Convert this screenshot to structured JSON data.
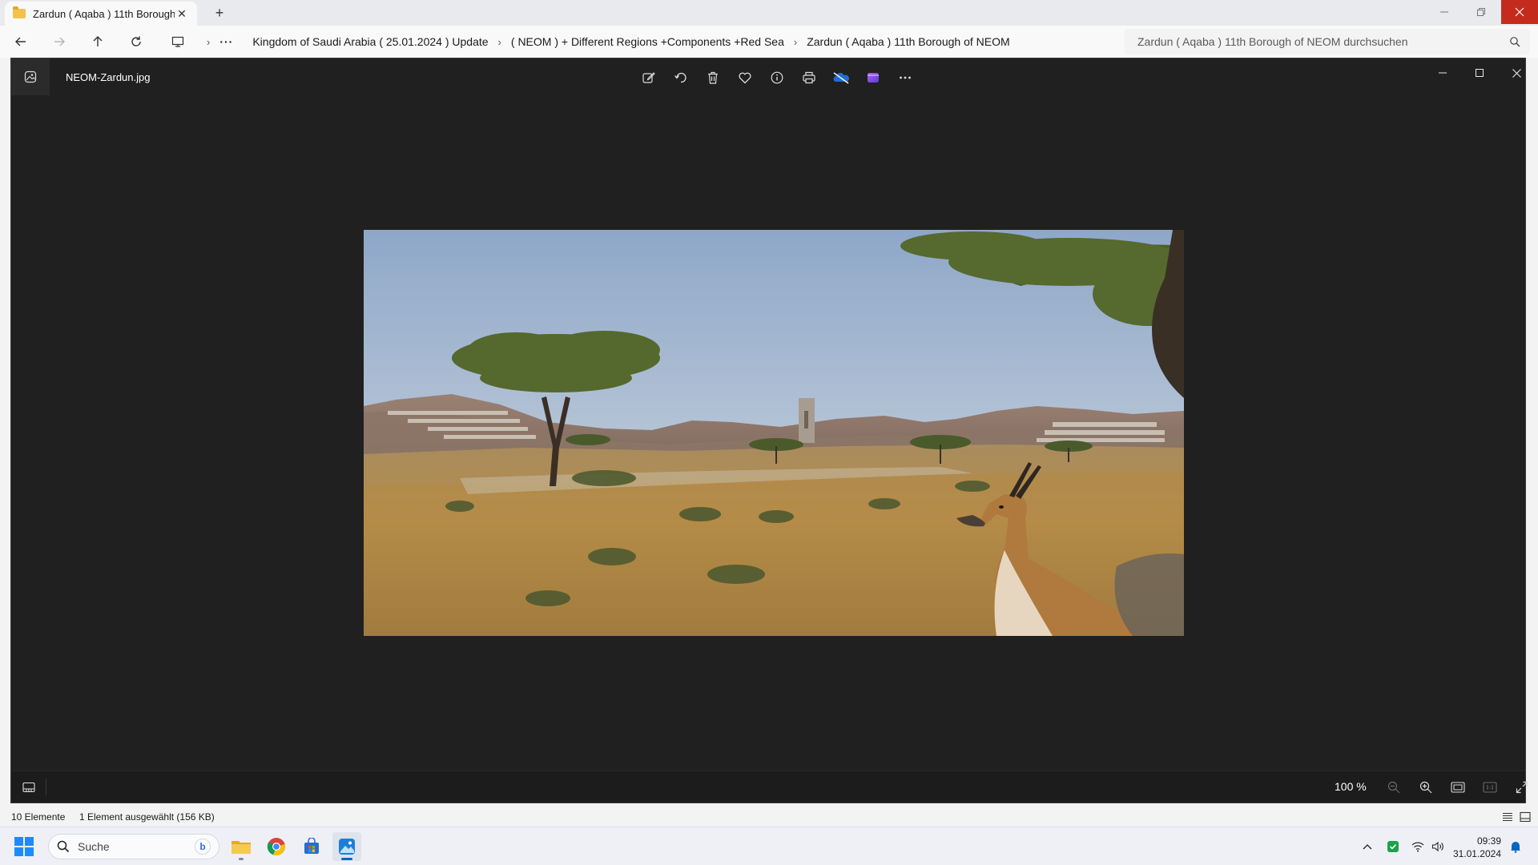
{
  "explorer": {
    "tab_title": "Zardun ( Aqaba )  11th Borough",
    "breadcrumbs": [
      "Kingdom of Saudi Arabia ( 25.01.2024 ) Update",
      "( NEOM ) + Different Regions +Components +Red Sea",
      "Zardun ( Aqaba )  11th Borough of NEOM"
    ],
    "search_placeholder": "Zardun ( Aqaba )  11th Borough of NEOM durchsuchen",
    "status_count": "10 Elemente",
    "status_selected": "1 Element ausgewählt (156 KB)"
  },
  "photos": {
    "filename": "NEOM-Zardun.jpg",
    "zoom": "100 %",
    "toolbar_icons": [
      "edit-icon",
      "rotate-icon",
      "delete-icon",
      "favorite-icon",
      "info-icon",
      "print-icon",
      "onedrive-icon",
      "clipchamp-icon",
      "more-icon"
    ]
  },
  "taskbar": {
    "search_label": "Suche",
    "time": "09:39",
    "date": "31.01.2024"
  },
  "colors": {
    "accent": "#0067c0",
    "close_red": "#c42b1c",
    "viewer_bg": "#202020"
  }
}
